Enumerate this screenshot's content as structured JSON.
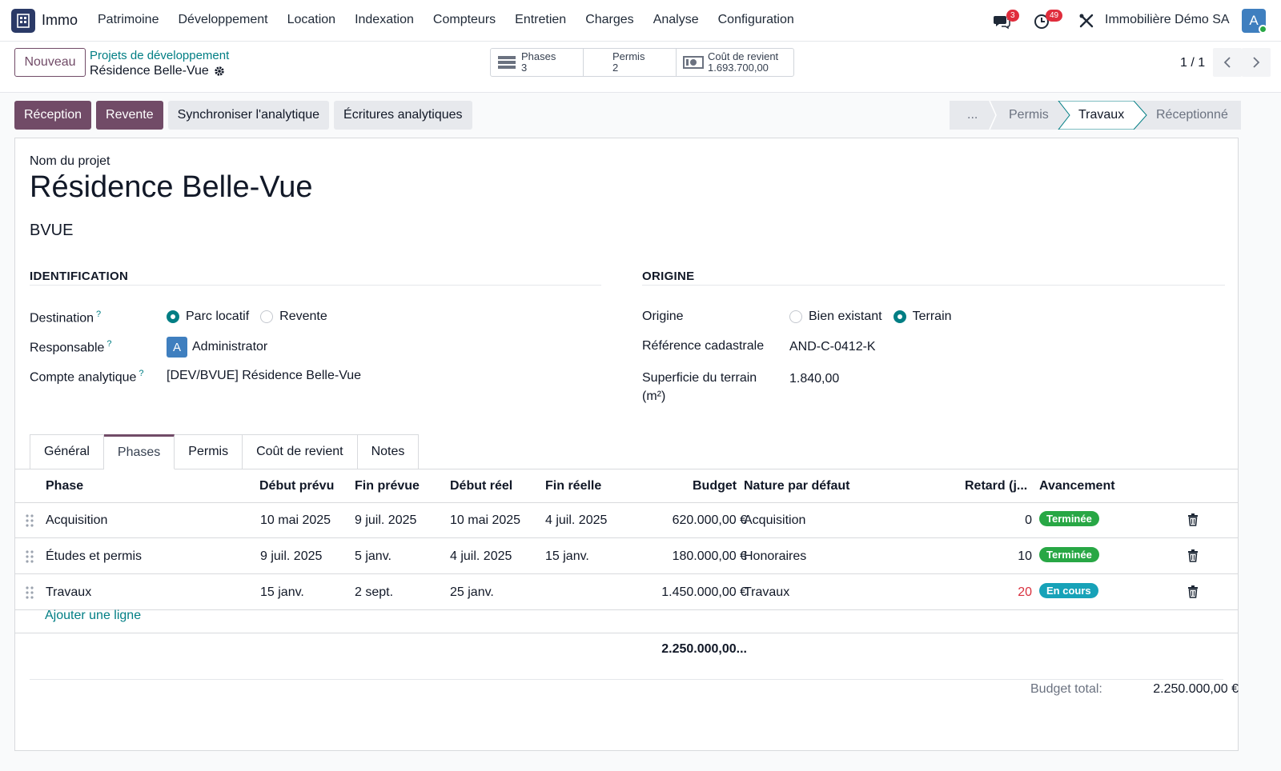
{
  "nav": {
    "app_name": "Immo",
    "menu": [
      "Patrimoine",
      "Développement",
      "Location",
      "Indexation",
      "Compteurs",
      "Entretien",
      "Charges",
      "Analyse",
      "Configuration"
    ],
    "messages_count": "3",
    "activities_count": "49",
    "company": "Immobilière Démo SA",
    "user_initial": "A"
  },
  "control": {
    "new_button": "Nouveau",
    "breadcrumb_parent": "Projets de développement",
    "record_name": "Résidence Belle-Vue",
    "stats": [
      {
        "label": "Phases",
        "value": "3",
        "icon": "list-icon"
      },
      {
        "label": "Permis",
        "value": "2",
        "icon": ""
      },
      {
        "label": "Coût de revient",
        "value": "1.693.700,00",
        "icon": "money-icon"
      }
    ],
    "pager": "1 / 1"
  },
  "actions": {
    "buttons_primary": [
      "Réception",
      "Revente"
    ],
    "buttons_secondary": [
      "Synchroniser l'analytique",
      "Écritures analytiques"
    ]
  },
  "statusbar": {
    "stages": [
      "...",
      "Permis",
      "Travaux",
      "Réceptionné"
    ],
    "active": "Travaux"
  },
  "form": {
    "name_label": "Nom du projet",
    "name": "Résidence Belle-Vue",
    "code": "BVUE",
    "identification": {
      "title": "IDENTIFICATION",
      "destination_label": "Destination",
      "destination_options": [
        "Parc locatif",
        "Revente"
      ],
      "destination_selected": "Parc locatif",
      "responsable_label": "Responsable",
      "responsable_initial": "A",
      "responsable": "Administrator",
      "analytic_label": "Compte analytique",
      "analytic": "[DEV/BVUE] Résidence Belle-Vue",
      "help": "?"
    },
    "origine": {
      "title": "ORIGINE",
      "origine_label": "Origine",
      "origine_options": [
        "Bien existant",
        "Terrain"
      ],
      "origine_selected": "Terrain",
      "cadastre_label": "Référence cadastrale",
      "cadastre": "AND-C-0412-K",
      "surface_label_1": "Superficie du terrain",
      "surface_label_2": "(m²)",
      "surface": "1.840,00"
    }
  },
  "tabs": [
    "Général",
    "Phases",
    "Permis",
    "Coût de revient",
    "Notes"
  ],
  "active_tab": "Phases",
  "table": {
    "columns": [
      "Phase",
      "Début prévu",
      "Fin prévue",
      "Début réel",
      "Fin réelle",
      "Budget",
      "Nature par défaut",
      "Retard (j...",
      "Avancement"
    ],
    "rows": [
      {
        "phase": "Acquisition",
        "debut_prevu": "10 mai 2025",
        "fin_prevue": "9 juil. 2025",
        "debut_reel": "10 mai 2025",
        "fin_reelle": "4 juil. 2025",
        "budget": "620.000,00 €",
        "nature": "Acquisition",
        "retard": "0",
        "avancement": "Terminée",
        "status": "done"
      },
      {
        "phase": "Études et permis",
        "debut_prevu": "9 juil. 2025",
        "fin_prevue": "5 janv.",
        "debut_reel": "4 juil. 2025",
        "fin_reelle": "15 janv.",
        "budget": "180.000,00 €",
        "nature": "Honoraires",
        "retard": "10",
        "avancement": "Terminée",
        "status": "done"
      },
      {
        "phase": "Travaux",
        "debut_prevu": "15 janv.",
        "fin_prevue": "2 sept.",
        "debut_reel": "25 janv.",
        "fin_reelle": "",
        "budget": "1.450.000,00 €",
        "nature": "Travaux",
        "retard": "20",
        "avancement": "En cours",
        "status": "progress"
      }
    ],
    "add_line": "Ajouter une ligne",
    "total": "2.250.000,00..."
  },
  "footer": {
    "budget_label": "Budget total:",
    "budget_value": "2.250.000,00 €"
  },
  "colors": {
    "primary": "#714b67",
    "teal": "#017e84",
    "success": "#28a745",
    "info": "#17a2b8",
    "danger": "#d9303e"
  }
}
